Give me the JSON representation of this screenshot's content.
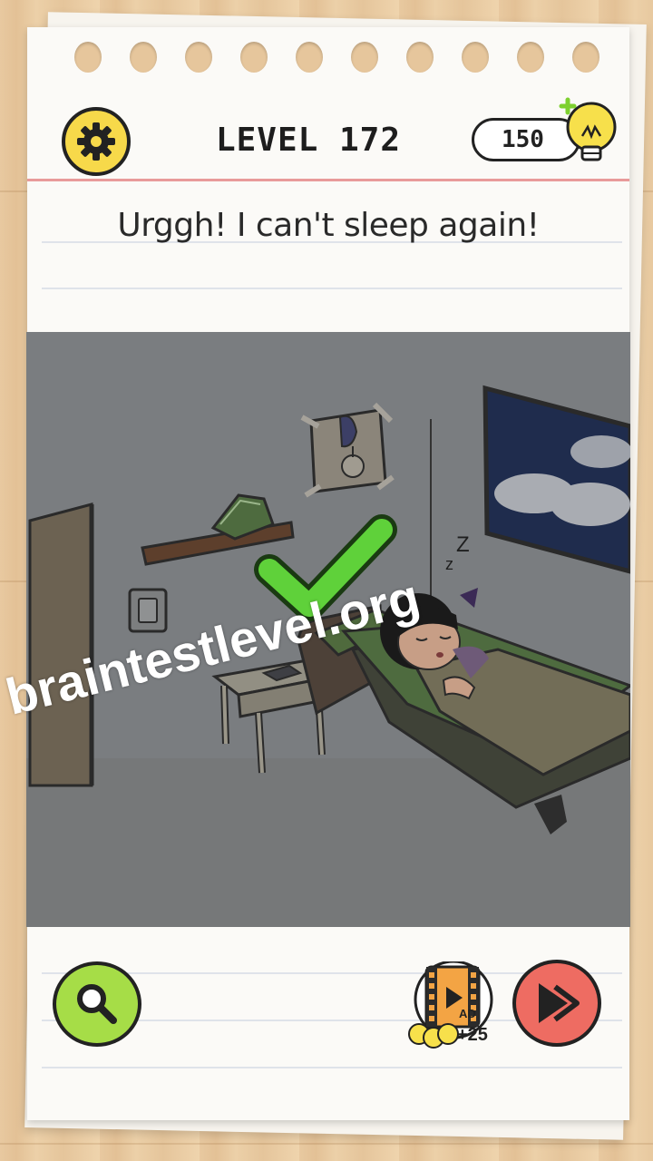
{
  "header": {
    "level_title": "LEVEL 172",
    "coins": "150",
    "settings_icon": "gear-icon",
    "hint_bulb_icon": "lightbulb-plus-icon"
  },
  "prompt": "Urggh! I can't sleep again!",
  "scene": {
    "description_elements": [
      "door",
      "light-switch",
      "shelf-with-book",
      "wall-clock",
      "bedside-table",
      "bed",
      "sleeping-girl",
      "night-window"
    ],
    "snore_text": "z Z",
    "result_icon": "checkmark-icon"
  },
  "watermark": "braintestlevel.org",
  "footer": {
    "hint_icon": "magnifier-icon",
    "ad_label": "AD",
    "ad_reward": "+25",
    "skip_icon": "skip-icon"
  },
  "colors": {
    "gear": "#f7d94a",
    "hint": "#a6dd47",
    "skip": "#ee6c62",
    "check": "#5fd13a",
    "rule_red": "#e89a9a"
  }
}
